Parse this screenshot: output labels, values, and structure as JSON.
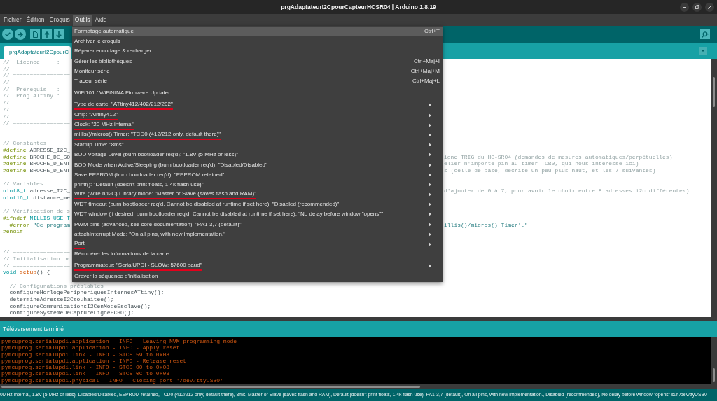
{
  "window": {
    "title": "prgAdaptateurI2CpourCapteurHCSR04 | Arduino 1.8.19"
  },
  "menu_bar": [
    {
      "label": "Fichier",
      "selected": false
    },
    {
      "label": "Édition",
      "selected": false
    },
    {
      "label": "Croquis",
      "selected": false
    },
    {
      "label": "Outils",
      "selected": true
    },
    {
      "label": "Aide",
      "selected": false
    }
  ],
  "tools_menu": {
    "sections": [
      {
        "items": [
          {
            "label": "Formatage automatique",
            "shortcut": "Ctrl+T",
            "selected": true,
            "underlined": false,
            "submenu": false
          },
          {
            "label": "Archiver le croquis",
            "selected": false,
            "underlined": false,
            "submenu": false
          },
          {
            "label": "Réparer encodage & recharger",
            "selected": false,
            "underlined": false,
            "submenu": false
          },
          {
            "label": "Gérer les bibliothèques",
            "shortcut": "Ctrl+Maj+I",
            "selected": false,
            "underlined": false,
            "submenu": false
          },
          {
            "label": "Moniteur série",
            "shortcut": "Ctrl+Maj+M",
            "selected": false,
            "underlined": false,
            "submenu": false
          },
          {
            "label": "Traceur série",
            "shortcut": "Ctrl+Maj+L",
            "selected": false,
            "underlined": false,
            "submenu": false
          }
        ]
      },
      {
        "items": [
          {
            "label": "WiFi101 / WiFiNINA Firmware Updater",
            "selected": false,
            "underlined": false,
            "submenu": false
          }
        ]
      },
      {
        "items": [
          {
            "label": "Type de carte: \"ATtiny412/402/212/202\"",
            "selected": false,
            "underlined": true,
            "submenu": true
          },
          {
            "label": "Chip: \"ATtiny412\"",
            "selected": false,
            "underlined": true,
            "submenu": true
          },
          {
            "label": "Clock: \"20 MHz internal\"",
            "selected": false,
            "underlined": true,
            "submenu": true
          },
          {
            "label": "millis()/micros() Timer: \"TCD0 (412/212 only, default there)\"",
            "selected": false,
            "underlined": true,
            "submenu": true
          },
          {
            "label": "Startup Time: \"8ms\"",
            "selected": false,
            "underlined": false,
            "submenu": true
          },
          {
            "label": "BOD Voltage Level (burn bootloader req'd): \"1.8V (5 MHz or less)\"",
            "selected": false,
            "underlined": false,
            "submenu": true
          },
          {
            "label": "BOD Mode when Active/Sleeping (burn bootloader req'd): \"Disabled/Disabled\"",
            "selected": false,
            "underlined": false,
            "submenu": true
          },
          {
            "label": "Save EEPROM (burn bootloader req'd): \"EEPROM retained\"",
            "selected": false,
            "underlined": false,
            "submenu": true
          },
          {
            "label": "printf(): \"Default (doesn't print floats, 1.4k flash use)\"",
            "selected": false,
            "underlined": false,
            "submenu": true
          },
          {
            "label": "Wire (Wire.h/I2C) Library mode: \"Master or Slave (saves flash and RAM)\"",
            "selected": false,
            "underlined": true,
            "submenu": true
          },
          {
            "label": "WDT timeout (burn bootloader req'd. Cannot be disabled at runtime if set here): \"Disabled (recommended)\"",
            "selected": false,
            "underlined": false,
            "submenu": true
          },
          {
            "label": "WDT window (if desired. burn bootloader req'd. Cannot be disabled at runtime if set here): \"No delay before window \"opens\"\"",
            "selected": false,
            "underlined": false,
            "submenu": true
          },
          {
            "label": "PWM pins (advanced, see core documentation): \"PA1-3,7 (default)\"",
            "selected": false,
            "underlined": false,
            "submenu": true
          },
          {
            "label": "attachInterrupt Mode: \"On all pins, with new implementation.\"",
            "selected": false,
            "underlined": false,
            "submenu": true
          },
          {
            "label": "Port",
            "selected": false,
            "underlined": true,
            "submenu": true
          },
          {
            "label": "Récupérer les informations de la carte",
            "selected": false,
            "underlined": false,
            "submenu": false
          }
        ]
      },
      {
        "items": [
          {
            "label": "Programmateur: \"SerialUPDI - SLOW: 57600 baud\"",
            "selected": false,
            "underlined": true,
            "submenu": true
          },
          {
            "label": "Graver la séquence d'initialisation",
            "selected": false,
            "underlined": false,
            "submenu": false
          }
        ]
      }
    ]
  },
  "tabs": [
    {
      "label": "prgAdaptateurI2CpourC",
      "selected": true
    }
  ],
  "editor": {
    "lines": [
      {
        "kind": "code",
        "left": [
          {
            "text": "//  Licence     :",
            "kind": "comment"
          }
        ]
      },
      {
        "kind": "code",
        "left": [
          {
            "text": "//",
            "kind": "comment"
          }
        ]
      },
      {
        "kind": "code",
        "left": [
          {
            "text": "// =================",
            "kind": "comment"
          }
        ]
      },
      {
        "kind": "code",
        "left": [
          {
            "text": "//",
            "kind": "comment"
          }
        ]
      },
      {
        "kind": "code",
        "left": [
          {
            "text": "//  Prérequis   :",
            "kind": "comment"
          }
        ]
      },
      {
        "kind": "code",
        "left": [
          {
            "text": "//  Prog ATtiny :",
            "kind": "comment"
          }
        ]
      },
      {
        "kind": "code",
        "left": [
          {
            "text": "//",
            "kind": "comment"
          }
        ]
      },
      {
        "kind": "code",
        "left": [
          {
            "text": "//",
            "kind": "comment"
          }
        ]
      },
      {
        "kind": "code",
        "left": [
          {
            "text": "//",
            "kind": "comment"
          }
        ]
      },
      {
        "kind": "code",
        "left": [
          {
            "text": "// =================",
            "kind": "comment"
          }
        ]
      },
      {
        "kind": "blank"
      },
      {
        "kind": "blank"
      },
      {
        "kind": "code",
        "left": [
          {
            "text": "// Constantes",
            "kind": "comment"
          }
        ]
      },
      {
        "kind": "code",
        "left": [
          {
            "text": "#define",
            "kind": "keyword"
          },
          {
            "text": " ADRESSE_I2C_",
            "kind": "plain"
          }
        ]
      },
      {
        "kind": "code",
        "left": [
          {
            "text": "#define",
            "kind": "keyword"
          },
          {
            "text": " BROCHE_DE_SO",
            "kind": "plain"
          }
        ],
        "right": [
          {
            "text": "igne TRIG du HC-SR04 (demandes de mesures automatiques/perpétuelles)",
            "kind": "comment"
          }
        ]
      },
      {
        "kind": "code",
        "left": [
          {
            "text": "#define",
            "kind": "keyword"
          },
          {
            "text": " BROCHE_D_ENT",
            "kind": "plain"
          }
        ],
        "right": [
          {
            "text": "elier n'importe pin au timer TCB0, qui nous intéresse ici)",
            "kind": "comment"
          }
        ]
      },
      {
        "kind": "code",
        "left": [
          {
            "text": "#define",
            "kind": "keyword"
          },
          {
            "text": " BROCHE_D_ENT",
            "kind": "plain"
          }
        ],
        "right": [
          {
            "text": "s (celle de base, décrite un peu plus haut, et les 7 suivantes)",
            "kind": "comment"
          }
        ]
      },
      {
        "kind": "blank"
      },
      {
        "kind": "code",
        "left": [
          {
            "text": "// Variables",
            "kind": "comment"
          }
        ]
      },
      {
        "kind": "code",
        "left": [
          {
            "text": "uint8_t",
            "kind": "type"
          },
          {
            "text": " adresse_I2C_",
            "kind": "plain"
          }
        ],
        "right": [
          {
            "text": "d'ajouter de 0 à 7, pour avoir le choix entre 8 adresses i2c différentes)",
            "kind": "comment"
          }
        ]
      },
      {
        "kind": "code",
        "left": [
          {
            "text": "uint16_t",
            "kind": "type"
          },
          {
            "text": " distance_me",
            "kind": "plain"
          }
        ]
      },
      {
        "kind": "blank"
      },
      {
        "kind": "code",
        "left": [
          {
            "text": "// Vérification de s",
            "kind": "comment"
          }
        ]
      },
      {
        "kind": "code",
        "left": [
          {
            "text": "#ifndef ",
            "kind": "keyword"
          },
          {
            "text": "MILLIS_USE_T",
            "kind": "type"
          }
        ]
      },
      {
        "kind": "code",
        "left": [
          {
            "text": "  #error",
            "kind": "keyword"
          },
          {
            "text": " \"Ce program",
            "kind": "string"
          }
        ],
        "right": [
          {
            "text": "illis()/micros() Timer'.\"",
            "kind": "string"
          }
        ]
      },
      {
        "kind": "code",
        "left": [
          {
            "text": "#endif",
            "kind": "keyword"
          }
        ]
      },
      {
        "kind": "blank"
      },
      {
        "kind": "blank"
      },
      {
        "kind": "code",
        "left": [
          {
            "text": "// =================",
            "kind": "comment"
          }
        ]
      },
      {
        "kind": "code",
        "left": [
          {
            "text": "// Initialisation pr",
            "kind": "comment"
          }
        ]
      },
      {
        "kind": "code",
        "left": [
          {
            "text": "// =================",
            "kind": "comment"
          }
        ]
      },
      {
        "kind": "code",
        "left": [
          {
            "text": "void ",
            "kind": "type"
          },
          {
            "text": "setup",
            "kind": "function"
          },
          {
            "text": "() {",
            "kind": "plain"
          }
        ]
      },
      {
        "kind": "blank"
      },
      {
        "kind": "code",
        "left": [
          {
            "text": "  // Configurations préalables",
            "kind": "comment"
          }
        ]
      },
      {
        "kind": "code",
        "left": [
          {
            "text": "  configureHorlogePeripheriquesInternesATtiny();",
            "kind": "plain"
          }
        ]
      },
      {
        "kind": "code",
        "left": [
          {
            "text": "  determineAdresseI2Csouhaitee();",
            "kind": "plain"
          }
        ]
      },
      {
        "kind": "code",
        "left": [
          {
            "text": "  configureCommunicationsI2CenModeEsclave();",
            "kind": "plain"
          }
        ]
      },
      {
        "kind": "code",
        "left": [
          {
            "text": "  configureSystemeDeCaptureLigneECHO();",
            "kind": "plain"
          }
        ]
      }
    ]
  },
  "console": {
    "header": "Téléversement terminé",
    "lines": [
      "pymcuprog.serialupdi.application - INFO - Leaving NVM programming mode",
      "pymcuprog.serialupdi.application - INFO - Apply reset",
      "pymcuprog.serialupdi.link - INFO - STCS 59 to 0x08",
      "pymcuprog.serialupdi.application - INFO - Release reset",
      "pymcuprog.serialupdi.link - INFO - STCS 00 to 0x08",
      "pymcuprog.serialupdi.link - INFO - STCS 0C to 0x03",
      "pymcuprog.serialupdi.physical - INFO - Closing port '/dev/ttyUSB0'"
    ]
  },
  "status_bar": {
    "text": "0MHz internal, 1.8V (5 MHz or less), Disabled/Disabled, EEPROM retained, TCD0 (412/212 only, default there), 8ms, Master or Slave (saves flash and RAM), Default (doesn't print floats, 1.4k flash use), PA1-3,7 (default), On all pins, with new implementation., Disabled (recommended), No delay before window \"opens\" sur /dev/ttyUSB0"
  }
}
